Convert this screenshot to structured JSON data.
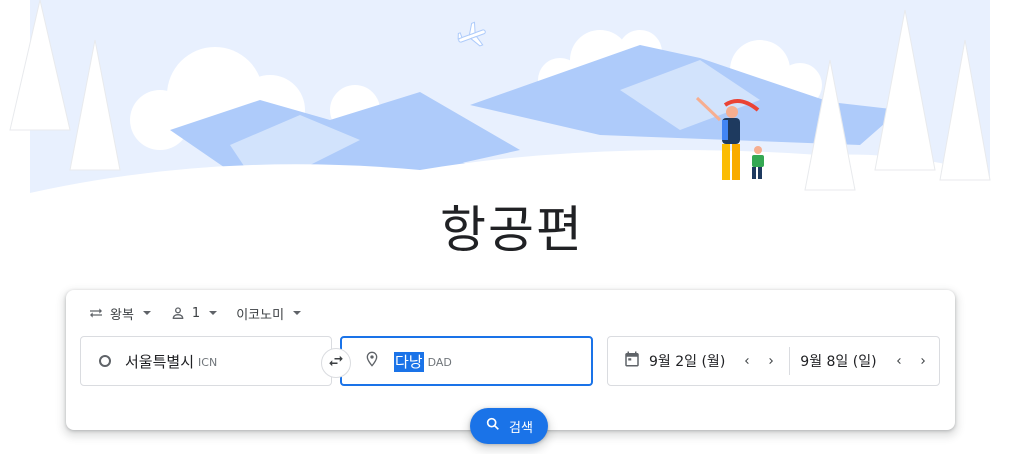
{
  "page": {
    "title": "항공편"
  },
  "options": {
    "trip_type": "왕복",
    "passengers": "1",
    "cabin_class": "이코노미"
  },
  "search_form": {
    "origin": {
      "city": "서울특별시",
      "code": "ICN"
    },
    "destination": {
      "city": "다낭",
      "code": "DAD"
    },
    "depart_date": "9월 2일 (월)",
    "return_date": "9월 8일 (일)",
    "search_label": "검색"
  },
  "colors": {
    "accent": "#1a73e8",
    "hero_blue": "#aecbfa",
    "hero_light": "#e8f0fe"
  }
}
